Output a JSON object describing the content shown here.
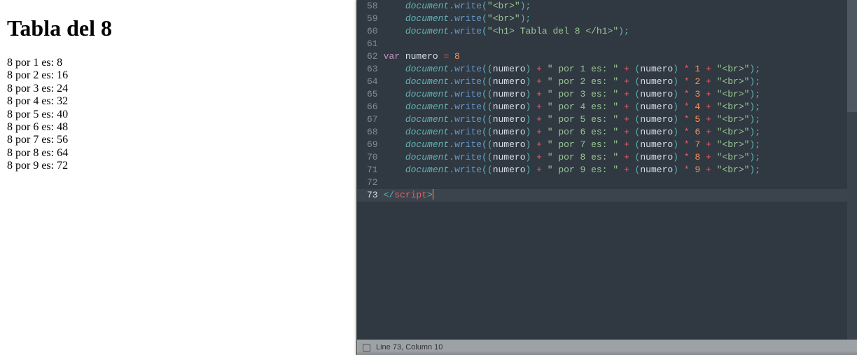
{
  "browser": {
    "heading": "Tabla del 8",
    "lines": [
      "8 por 1 es: 8",
      "8 por 2 es: 16",
      "8 por 3 es: 24",
      "8 por 4 es: 32",
      "8 por 5 es: 40",
      "8 por 6 es: 48",
      "8 por 7 es: 56",
      "8 por 8 es: 64",
      "8 por 9 es: 72"
    ]
  },
  "editor": {
    "first_line_number": 58,
    "active_line_number": 73,
    "status": "Line 73, Column 10",
    "lines": [
      [
        [
          "    ",
          ""
        ],
        [
          "document",
          "doc"
        ],
        [
          ".",
          "punc"
        ],
        [
          "write",
          "meth"
        ],
        [
          "(",
          "punc"
        ],
        [
          "\"<br>\"",
          "str"
        ],
        [
          ")",
          "punc"
        ],
        [
          ";",
          "punc"
        ]
      ],
      [
        [
          "    ",
          ""
        ],
        [
          "document",
          "doc"
        ],
        [
          ".",
          "punc"
        ],
        [
          "write",
          "meth"
        ],
        [
          "(",
          "punc"
        ],
        [
          "\"<br>\"",
          "str"
        ],
        [
          ")",
          "punc"
        ],
        [
          ";",
          "punc"
        ]
      ],
      [
        [
          "    ",
          ""
        ],
        [
          "document",
          "doc"
        ],
        [
          ".",
          "punc"
        ],
        [
          "write",
          "meth"
        ],
        [
          "(",
          "punc"
        ],
        [
          "\"<h1> Tabla del 8 </h1>\"",
          "str"
        ],
        [
          ")",
          "punc"
        ],
        [
          ";",
          "punc"
        ]
      ],
      [],
      [
        [
          "var ",
          "kw"
        ],
        [
          "numero ",
          "var"
        ],
        [
          "= ",
          "op"
        ],
        [
          "8",
          "num"
        ]
      ],
      [
        [
          "    ",
          ""
        ],
        [
          "document",
          "doc"
        ],
        [
          ".",
          "punc"
        ],
        [
          "write",
          "meth"
        ],
        [
          "((",
          "punc"
        ],
        [
          "numero",
          "var"
        ],
        [
          ") ",
          "punc"
        ],
        [
          "+ ",
          "op"
        ],
        [
          "\" por 1 es: \"",
          "str"
        ],
        [
          " + ",
          "op"
        ],
        [
          "(",
          "punc"
        ],
        [
          "numero",
          "var"
        ],
        [
          ") ",
          "punc"
        ],
        [
          "* ",
          "op"
        ],
        [
          "1",
          "num"
        ],
        [
          " + ",
          "op"
        ],
        [
          "\"<br>\"",
          "str"
        ],
        [
          ")",
          "punc"
        ],
        [
          ";",
          "punc"
        ]
      ],
      [
        [
          "    ",
          ""
        ],
        [
          "document",
          "doc"
        ],
        [
          ".",
          "punc"
        ],
        [
          "write",
          "meth"
        ],
        [
          "((",
          "punc"
        ],
        [
          "numero",
          "var"
        ],
        [
          ") ",
          "punc"
        ],
        [
          "+ ",
          "op"
        ],
        [
          "\" por 2 es: \"",
          "str"
        ],
        [
          " + ",
          "op"
        ],
        [
          "(",
          "punc"
        ],
        [
          "numero",
          "var"
        ],
        [
          ") ",
          "punc"
        ],
        [
          "* ",
          "op"
        ],
        [
          "2",
          "num"
        ],
        [
          " + ",
          "op"
        ],
        [
          "\"<br>\"",
          "str"
        ],
        [
          ")",
          "punc"
        ],
        [
          ";",
          "punc"
        ]
      ],
      [
        [
          "    ",
          ""
        ],
        [
          "document",
          "doc"
        ],
        [
          ".",
          "punc"
        ],
        [
          "write",
          "meth"
        ],
        [
          "((",
          "punc"
        ],
        [
          "numero",
          "var"
        ],
        [
          ") ",
          "punc"
        ],
        [
          "+ ",
          "op"
        ],
        [
          "\" por 3 es: \"",
          "str"
        ],
        [
          " + ",
          "op"
        ],
        [
          "(",
          "punc"
        ],
        [
          "numero",
          "var"
        ],
        [
          ") ",
          "punc"
        ],
        [
          "* ",
          "op"
        ],
        [
          "3",
          "num"
        ],
        [
          " + ",
          "op"
        ],
        [
          "\"<br>\"",
          "str"
        ],
        [
          ")",
          "punc"
        ],
        [
          ";",
          "punc"
        ]
      ],
      [
        [
          "    ",
          ""
        ],
        [
          "document",
          "doc"
        ],
        [
          ".",
          "punc"
        ],
        [
          "write",
          "meth"
        ],
        [
          "((",
          "punc"
        ],
        [
          "numero",
          "var"
        ],
        [
          ") ",
          "punc"
        ],
        [
          "+ ",
          "op"
        ],
        [
          "\" por 4 es: \"",
          "str"
        ],
        [
          " + ",
          "op"
        ],
        [
          "(",
          "punc"
        ],
        [
          "numero",
          "var"
        ],
        [
          ") ",
          "punc"
        ],
        [
          "* ",
          "op"
        ],
        [
          "4",
          "num"
        ],
        [
          " + ",
          "op"
        ],
        [
          "\"<br>\"",
          "str"
        ],
        [
          ")",
          "punc"
        ],
        [
          ";",
          "punc"
        ]
      ],
      [
        [
          "    ",
          ""
        ],
        [
          "document",
          "doc"
        ],
        [
          ".",
          "punc"
        ],
        [
          "write",
          "meth"
        ],
        [
          "((",
          "punc"
        ],
        [
          "numero",
          "var"
        ],
        [
          ") ",
          "punc"
        ],
        [
          "+ ",
          "op"
        ],
        [
          "\" por 5 es: \"",
          "str"
        ],
        [
          " + ",
          "op"
        ],
        [
          "(",
          "punc"
        ],
        [
          "numero",
          "var"
        ],
        [
          ") ",
          "punc"
        ],
        [
          "* ",
          "op"
        ],
        [
          "5",
          "num"
        ],
        [
          " + ",
          "op"
        ],
        [
          "\"<br>\"",
          "str"
        ],
        [
          ")",
          "punc"
        ],
        [
          ";",
          "punc"
        ]
      ],
      [
        [
          "    ",
          ""
        ],
        [
          "document",
          "doc"
        ],
        [
          ".",
          "punc"
        ],
        [
          "write",
          "meth"
        ],
        [
          "((",
          "punc"
        ],
        [
          "numero",
          "var"
        ],
        [
          ") ",
          "punc"
        ],
        [
          "+ ",
          "op"
        ],
        [
          "\" por 6 es: \"",
          "str"
        ],
        [
          " + ",
          "op"
        ],
        [
          "(",
          "punc"
        ],
        [
          "numero",
          "var"
        ],
        [
          ") ",
          "punc"
        ],
        [
          "* ",
          "op"
        ],
        [
          "6",
          "num"
        ],
        [
          " + ",
          "op"
        ],
        [
          "\"<br>\"",
          "str"
        ],
        [
          ")",
          "punc"
        ],
        [
          ";",
          "punc"
        ]
      ],
      [
        [
          "    ",
          ""
        ],
        [
          "document",
          "doc"
        ],
        [
          ".",
          "punc"
        ],
        [
          "write",
          "meth"
        ],
        [
          "((",
          "punc"
        ],
        [
          "numero",
          "var"
        ],
        [
          ") ",
          "punc"
        ],
        [
          "+ ",
          "op"
        ],
        [
          "\" por 7 es: \"",
          "str"
        ],
        [
          " + ",
          "op"
        ],
        [
          "(",
          "punc"
        ],
        [
          "numero",
          "var"
        ],
        [
          ") ",
          "punc"
        ],
        [
          "* ",
          "op"
        ],
        [
          "7",
          "num"
        ],
        [
          " + ",
          "op"
        ],
        [
          "\"<br>\"",
          "str"
        ],
        [
          ")",
          "punc"
        ],
        [
          ";",
          "punc"
        ]
      ],
      [
        [
          "    ",
          ""
        ],
        [
          "document",
          "doc"
        ],
        [
          ".",
          "punc"
        ],
        [
          "write",
          "meth"
        ],
        [
          "((",
          "punc"
        ],
        [
          "numero",
          "var"
        ],
        [
          ") ",
          "punc"
        ],
        [
          "+ ",
          "op"
        ],
        [
          "\" por 8 es: \"",
          "str"
        ],
        [
          " + ",
          "op"
        ],
        [
          "(",
          "punc"
        ],
        [
          "numero",
          "var"
        ],
        [
          ") ",
          "punc"
        ],
        [
          "* ",
          "op"
        ],
        [
          "8",
          "num"
        ],
        [
          " + ",
          "op"
        ],
        [
          "\"<br>\"",
          "str"
        ],
        [
          ")",
          "punc"
        ],
        [
          ";",
          "punc"
        ]
      ],
      [
        [
          "    ",
          ""
        ],
        [
          "document",
          "doc"
        ],
        [
          ".",
          "punc"
        ],
        [
          "write",
          "meth"
        ],
        [
          "((",
          "punc"
        ],
        [
          "numero",
          "var"
        ],
        [
          ") ",
          "punc"
        ],
        [
          "+ ",
          "op"
        ],
        [
          "\" por 9 es: \"",
          "str"
        ],
        [
          " + ",
          "op"
        ],
        [
          "(",
          "punc"
        ],
        [
          "numero",
          "var"
        ],
        [
          ") ",
          "punc"
        ],
        [
          "* ",
          "op"
        ],
        [
          "9",
          "num"
        ],
        [
          " + ",
          "op"
        ],
        [
          "\"<br>\"",
          "str"
        ],
        [
          ")",
          "punc"
        ],
        [
          ";",
          "punc"
        ]
      ],
      [],
      [
        [
          "</",
          "punc"
        ],
        [
          "script",
          "tag"
        ],
        [
          ">",
          "punc"
        ]
      ]
    ]
  }
}
